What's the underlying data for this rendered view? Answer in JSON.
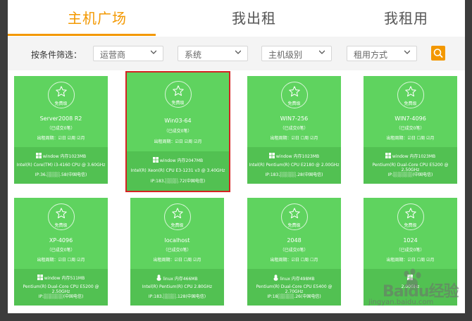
{
  "tabs": [
    {
      "label": "主机广场"
    },
    {
      "label": "我出租"
    },
    {
      "label": "我租用"
    }
  ],
  "filters": {
    "label": "按条件筛选：",
    "selects": [
      {
        "value": "运营商"
      },
      {
        "value": "系统"
      },
      {
        "value": "主机级别"
      },
      {
        "value": "租用方式"
      }
    ]
  },
  "colors": {
    "accent": "#f39800",
    "card": "#5fd35f",
    "card_footer": "#52c152",
    "selected_border": "#d42222"
  },
  "cards": [
    {
      "badge": "免费级",
      "name": "Server2008 R2",
      "rented": "（已成交0笔）",
      "period": "出租周期：☑日 ☑周 ☑月",
      "os_icon": "windows-icon",
      "os": "window 内存1023MB",
      "cpu": "Intel(R) Core(TM) i3-4160 CPU @ 3.60GHz",
      "ip": "IP:36.░░░░.58(中国电信)"
    },
    {
      "badge": "免费级",
      "name": "Win03-64",
      "rented": "（已成交0笔）",
      "period": "出租周期：☑日 ☑周 ☑月",
      "os_icon": "windows-icon",
      "os": "window 内存2047MB",
      "cpu": "Intel(R) Xeon(R) CPU E3-1231 v3 @ 3.40GHz",
      "ip": "IP:183.░░░░.72(中国电信)"
    },
    {
      "badge": "免费级",
      "name": "WIN7-256",
      "rented": "（已成交0笔）",
      "period": "出租周期：☑日 ☐周 ☑月",
      "os_icon": "windows-icon",
      "os": "window 内存1023MB",
      "cpu": "Intel(R) Pentium(R) CPU E2180 @ 2.00GHz",
      "ip": "IP:183.░░░░░.28(中国电信)"
    },
    {
      "badge": "免费级",
      "name": "WIN7-4096",
      "rented": "（已成交0笔）",
      "period": "出租周期：☑日 ☐周 ☑月",
      "os_icon": "windows-icon",
      "os": "window 内存1023MB",
      "cpu": "Pentium(R) Dual-Core CPU E5200 @ 2.50GHz",
      "ip": "IP:░░░░░░(中国电信)"
    },
    {
      "badge": "免费级",
      "name": "XP-4096",
      "rented": "（已成交0笔）",
      "period": "出租周期：☑日 ☐周 ☑月",
      "os_icon": "windows-icon",
      "os": "window 内存511MB",
      "cpu": "Pentium(R) Dual-Core CPU E5200 @ 2.50GHz",
      "ip": "IP:░░░░░░(中国电信)"
    },
    {
      "badge": "免费级",
      "name": "localhost",
      "rented": "（已成交0笔）",
      "period": "出租周期：☑日 ☐周 ☑月",
      "os_icon": "linux-icon",
      "os": "linux 内存466MB",
      "cpu": "Intel(R) Pentium(R) CPU 2.80GHz",
      "ip": "IP:183.░░░░.128(中国电信)"
    },
    {
      "badge": "免费级",
      "name": "2048",
      "rented": "（已成交0笔）",
      "period": "出租周期：☑日 ☐周 ☐月",
      "os_icon": "linux-icon",
      "os": "linux 内存498MB",
      "cpu": "Pentium(R) Dual-Core CPU E5400 @ 2.70GHz",
      "ip": "IP:18░░░░░.26(中国电信)"
    },
    {
      "badge": "免费级",
      "name": "1024",
      "rented": "（已成交0笔）",
      "period": "出租周期：☑日 ☐周 ☑月",
      "os_icon": "windows-icon",
      "os": "",
      "cpu": "2.00GHz",
      "ip": ""
    }
  ],
  "watermark": {
    "logo": "Baidu经验",
    "url": "jingyan.baidu.com"
  }
}
